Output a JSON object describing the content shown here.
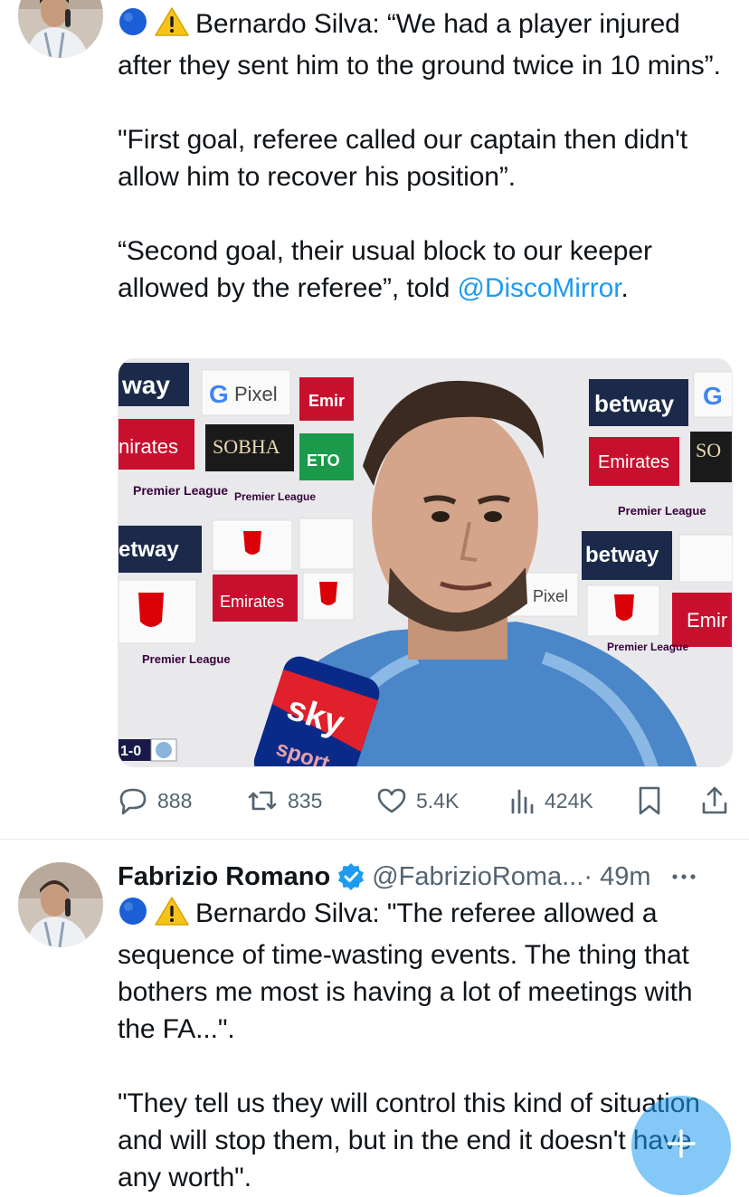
{
  "tweet1": {
    "paragraphs": [
      "Bernardo Silva: “We had a player injured after they sent him to the ground twice in 10 mins”.",
      "\"First goal, referee called our captain then didn't allow him to recover his position”.",
      "“Second goal, their usual block to our keeper allowed by the referee”, told "
    ],
    "mention": "@DiscoMirror",
    "mention_suffix": ".",
    "media": {
      "board_labels": [
        "way",
        "Pixel",
        "Emir",
        "nirates",
        "SOBHA",
        "ETO",
        "Premier League",
        "Premier League",
        "etway",
        "Emirates",
        "Premier League",
        "betway",
        "Emirates",
        "SO",
        "Premier League",
        "betway",
        "Pixel",
        "Emir",
        "Premier League"
      ],
      "broadcaster": "sky",
      "broadcaster_sub": "sport",
      "score": "1-0"
    },
    "actions": {
      "replies": "888",
      "reposts": "835",
      "likes": "5.4K",
      "views": "424K"
    }
  },
  "tweet2": {
    "name": "Fabrizio Romano",
    "handle": "@FabrizioRoma...",
    "time": "· 49m",
    "paragraphs": [
      "Bernardo Silva: \"The referee allowed a sequence of time-wasting events. The thing that bothers me most is having a lot of meetings with the FA...\".",
      "\"They tell us they will control this kind of situation and will stop them, but in the end it doesn't have any worth\"."
    ]
  },
  "colors": {
    "accent": "#1d9bf0",
    "muted": "#536471",
    "text": "#0f1419"
  }
}
